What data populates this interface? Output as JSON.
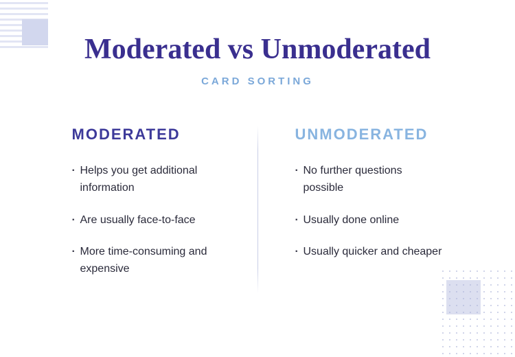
{
  "header": {
    "title": "Moderated vs Unmoderated",
    "subtitle": "CARD SORTING"
  },
  "columns": {
    "left": {
      "heading": "MODERATED",
      "items": [
        "Helps you get additional information",
        "Are usually face-to-face",
        "More time-consuming and expensive"
      ]
    },
    "right": {
      "heading": "UNMODERATED",
      "items": [
        "No further questions possible",
        "Usually done online",
        "Usually quicker and cheaper"
      ]
    }
  }
}
